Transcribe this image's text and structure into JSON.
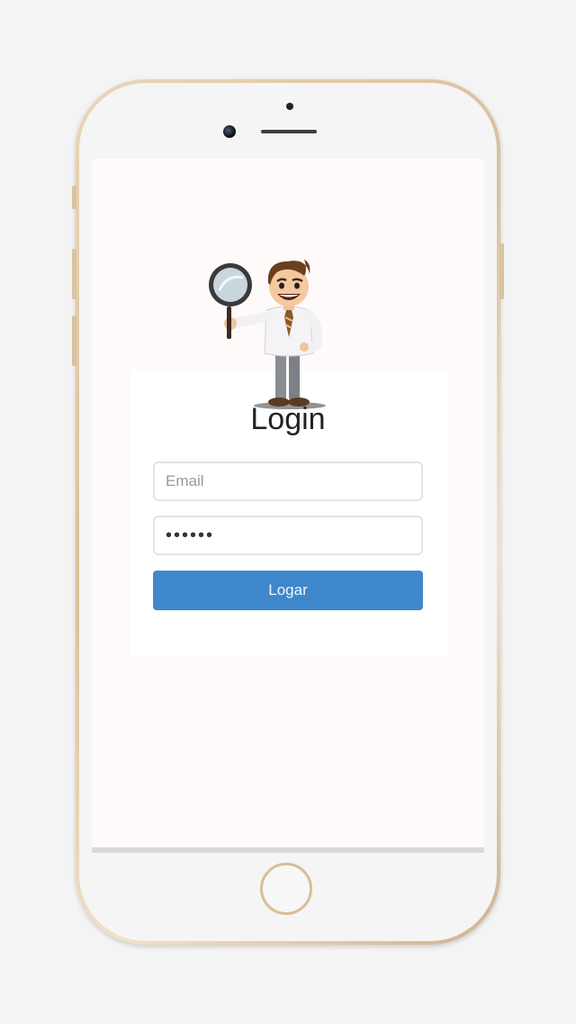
{
  "login": {
    "title": "Login",
    "email_placeholder": "Email",
    "email_value": "",
    "password_value": "••••••",
    "submit_label": "Logar"
  },
  "colors": {
    "accent": "#3f87cc",
    "screen_background": "#fffafa",
    "phone_frame": "#d9c09a"
  },
  "icons": {
    "mascot": "detective-with-magnifying-glass-illustration"
  }
}
